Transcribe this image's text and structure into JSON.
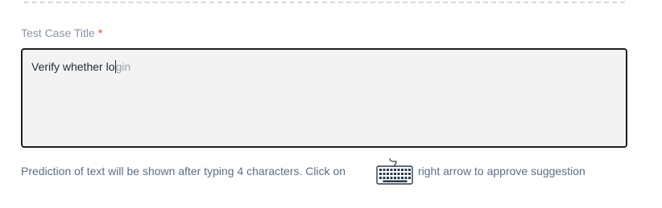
{
  "field": {
    "label": "Test Case Title",
    "required_marker": "*",
    "typed_text": "Verify whether lo",
    "suggestion_text": "gin"
  },
  "helper": {
    "text_before_icon": "Prediction of text will be shown after typing 4 characters. Click on",
    "text_after_icon": "right arrow to approve suggestion",
    "icon": "keyboard-icon"
  },
  "colors": {
    "label": "#8a94a3",
    "required": "#e53935",
    "textarea_bg": "#f3f3f3",
    "textarea_border": "#1c1f24",
    "suggestion": "#9aa1ab",
    "helper": "#5c6e82"
  }
}
